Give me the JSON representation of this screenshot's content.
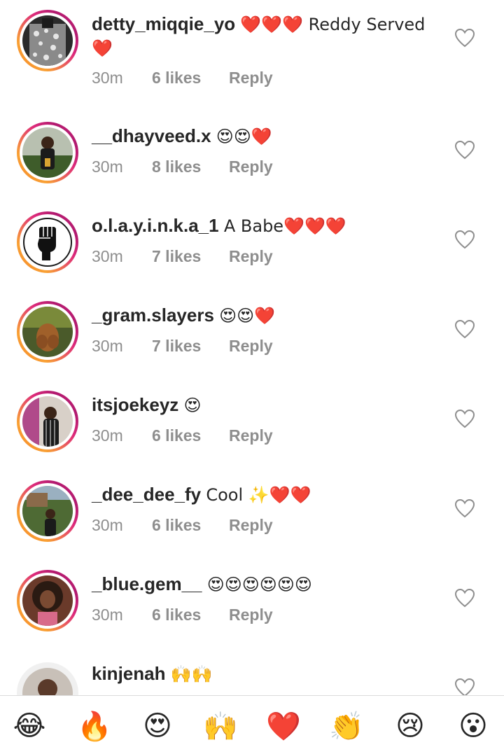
{
  "comments": [
    {
      "username": "detty_miqqie_yo",
      "text": "❤️❤️❤️ Reddy Served ❤️",
      "time": "30m",
      "likes": "6 likes",
      "reply": "Reply"
    },
    {
      "username": "__dhayveed.x",
      "text": "😍😍❤️",
      "time": "30m",
      "likes": "8 likes",
      "reply": "Reply"
    },
    {
      "username": "o.l.a.y.i.n.k.a_1",
      "text": "A Babe❤️❤️❤️",
      "time": "30m",
      "likes": "7 likes",
      "reply": "Reply"
    },
    {
      "username": "_gram.slayers",
      "text": "😍😍❤️",
      "time": "30m",
      "likes": "7 likes",
      "reply": "Reply"
    },
    {
      "username": "itsjoekeyz",
      "text": "😍",
      "time": "30m",
      "likes": "6 likes",
      "reply": "Reply"
    },
    {
      "username": "_dee_dee_fy",
      "text": "Cool ✨❤️❤️",
      "time": "30m",
      "likes": "6 likes",
      "reply": "Reply"
    },
    {
      "username": "_blue.gem__",
      "text": "😍😍😍😍😍😍",
      "time": "30m",
      "likes": "6 likes",
      "reply": "Reply"
    },
    {
      "username": "kinjenah",
      "text": "🙌🙌",
      "time": "",
      "likes": "",
      "reply": ""
    }
  ],
  "quick_reactions": [
    "😂",
    "🔥",
    "😍",
    "🙌",
    "❤️",
    "👏",
    "😢",
    "😮"
  ],
  "icons": {
    "like": "heart-outline-icon"
  },
  "colors": {
    "text": "#262626",
    "meta": "#8e8e8e",
    "ring_start": "#f58529",
    "ring_end": "#dd2a7b",
    "heart_emoji": "#e0102a"
  }
}
